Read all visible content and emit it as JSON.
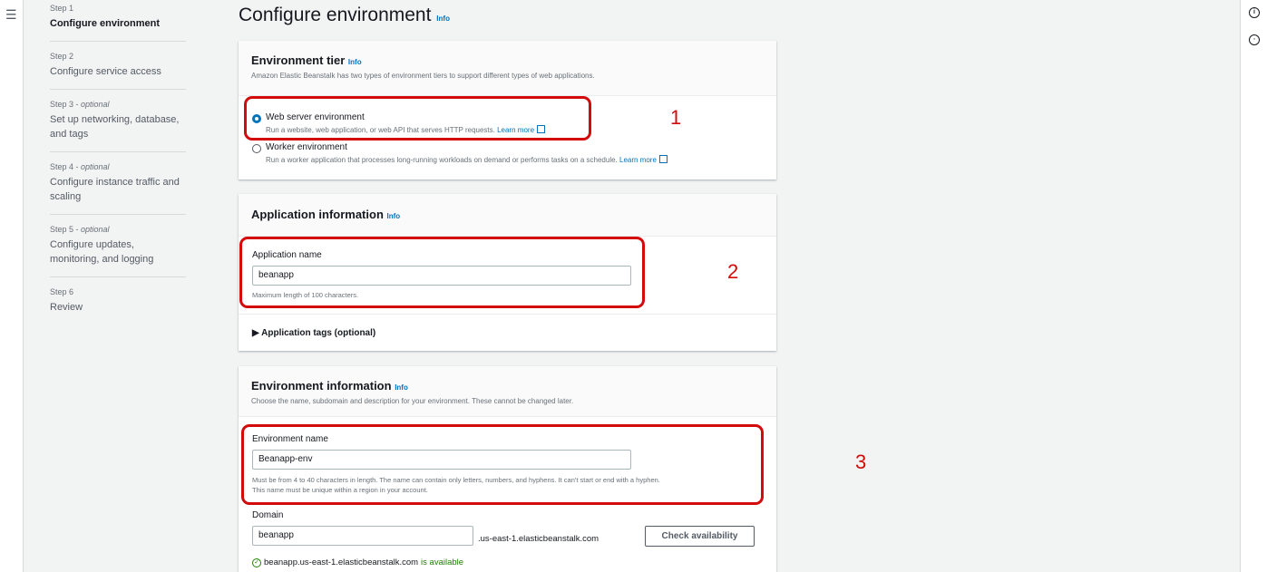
{
  "steps": [
    {
      "num": "Step 1",
      "optional": "",
      "title": "Configure environment"
    },
    {
      "num": "Step 2",
      "optional": "",
      "title": "Configure service access"
    },
    {
      "num": "Step 3 - ",
      "optional": "optional",
      "title": "Set up networking, database, and tags"
    },
    {
      "num": "Step 4 - ",
      "optional": "optional",
      "title": "Configure instance traffic and scaling"
    },
    {
      "num": "Step 5 - ",
      "optional": "optional",
      "title": "Configure updates, monitoring, and logging"
    },
    {
      "num": "Step 6",
      "optional": "",
      "title": "Review"
    }
  ],
  "page": {
    "title": "Configure environment",
    "info": "Info"
  },
  "tier": {
    "title": "Environment tier",
    "info": "Info",
    "desc": "Amazon Elastic Beanstalk has two types of environment tiers to support different types of web applications.",
    "web_label": "Web server environment",
    "web_desc": "Run a website, web application, or web API that serves HTTP requests.",
    "worker_label": "Worker environment",
    "worker_desc": "Run a worker application that processes long-running workloads on demand or performs tasks on a schedule.",
    "learn_more": "Learn more"
  },
  "app": {
    "title": "Application information",
    "info": "Info",
    "name_label": "Application name",
    "name_value": "beanapp",
    "name_hint": "Maximum length of 100 characters.",
    "tags_label": "Application tags (optional)"
  },
  "env": {
    "title": "Environment information",
    "info": "Info",
    "desc": "Choose the name, subdomain and description for your environment. These cannot be changed later.",
    "name_label": "Environment name",
    "name_value": "Beanapp-env",
    "name_hint_1": "Must be from 4 to 40 characters in length. The name can contain only letters, numbers, and hyphens. It can't start or end with a hyphen.",
    "name_hint_2": "This name must be unique within a region in your account.",
    "domain_label": "Domain",
    "domain_value": "beanapp",
    "domain_suffix": ".us-east-1.elasticbeanstalk.com",
    "check_button": "Check availability",
    "avail_domain": "beanapp.us-east-1.elasticbeanstalk.com",
    "avail_status": "is available"
  },
  "annotations": [
    "1",
    "2",
    "3"
  ],
  "colors": {
    "accent": "#0073bb",
    "annotation": "#d40b0b",
    "success": "#1d8102"
  }
}
